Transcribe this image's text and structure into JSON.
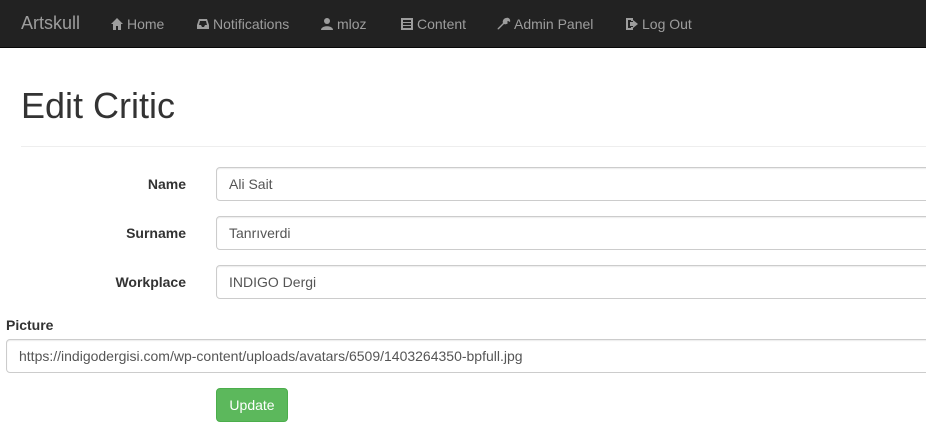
{
  "navbar": {
    "brand": "Artskull",
    "items": [
      {
        "label": "Home",
        "icon": "home-icon"
      },
      {
        "label": "Notifications",
        "icon": "inbox-icon"
      },
      {
        "label": "mloz",
        "icon": "user-icon"
      },
      {
        "label": "Content",
        "icon": "list-icon"
      },
      {
        "label": "Admin Panel",
        "icon": "wrench-icon"
      },
      {
        "label": "Log Out",
        "icon": "log-out-icon"
      }
    ]
  },
  "page": {
    "title": "Edit Critic"
  },
  "form": {
    "name_label": "Name",
    "name_value": "Ali Sait",
    "surname_label": "Surname",
    "surname_value": "Tanrıverdi",
    "workplace_label": "Workplace",
    "workplace_value": "INDIGO Dergi",
    "picture_label": "Picture",
    "picture_value": "https://indigodergisi.com/wp-content/uploads/avatars/6509/1403264350-bpfull.jpg",
    "submit_label": "Update"
  },
  "colors": {
    "navbar_bg": "#222222",
    "nav_text": "#9d9d9d",
    "button_green": "#5cb85c"
  }
}
